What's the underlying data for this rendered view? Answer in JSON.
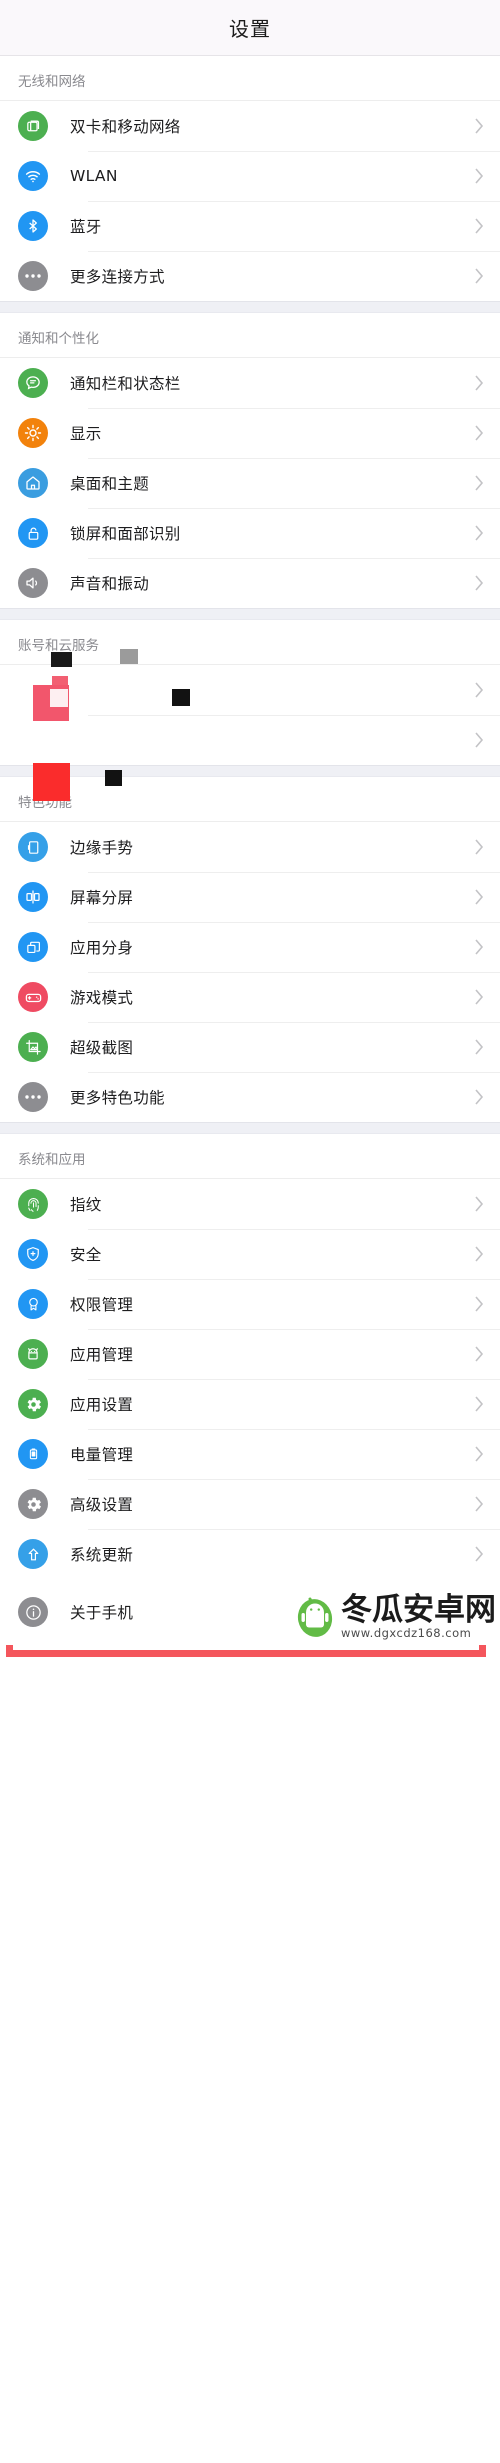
{
  "header": {
    "title": "设置"
  },
  "colors": {
    "green": "#4caf50",
    "blue": "#2196f3",
    "light_blue": "#35a0e8",
    "orange": "#f2820c",
    "gray": "#8d8d91",
    "red_pink": "#ef4b62",
    "highlight_border": "#f4565c",
    "page_bg": "#eff0f5",
    "titlebar_bg": "#faf8fb"
  },
  "sections": [
    {
      "title": "无线和网络",
      "items": [
        {
          "label": "双卡和移动网络",
          "icon": "sim-card-icon",
          "icon_color": "#4caf50"
        },
        {
          "label": "WLAN",
          "icon": "wifi-icon",
          "icon_color": "#2196f3"
        },
        {
          "label": "蓝牙",
          "icon": "bluetooth-icon",
          "icon_color": "#2196f3"
        },
        {
          "label": "更多连接方式",
          "icon": "more-dots-icon",
          "icon_color": "#8d8d91"
        }
      ]
    },
    {
      "title": "通知和个性化",
      "items": [
        {
          "label": "通知栏和状态栏",
          "icon": "chat-bubble-icon",
          "icon_color": "#4caf50"
        },
        {
          "label": "显示",
          "icon": "brightness-sun-icon",
          "icon_color": "#f2820c"
        },
        {
          "label": "桌面和主题",
          "icon": "home-icon",
          "icon_color": "#3a9de0"
        },
        {
          "label": "锁屏和面部识别",
          "icon": "lock-icon",
          "icon_color": "#2196f3"
        },
        {
          "label": "声音和振动",
          "icon": "speaker-icon",
          "icon_color": "#8d8d91"
        }
      ]
    },
    {
      "title": "账号和云服务",
      "redacted": true,
      "items": [
        {
          "label": "",
          "icon": "redacted-icon",
          "icon_color": "#ffffff"
        },
        {
          "label": "",
          "icon": "redacted-icon",
          "icon_color": "#ffffff"
        }
      ]
    },
    {
      "title": "特色功能",
      "items": [
        {
          "label": "边缘手势",
          "icon": "edge-gesture-icon",
          "icon_color": "#35a0e8"
        },
        {
          "label": "屏幕分屏",
          "icon": "split-screen-icon",
          "icon_color": "#2196f3"
        },
        {
          "label": "应用分身",
          "icon": "app-clone-icon",
          "icon_color": "#2196f3"
        },
        {
          "label": "游戏模式",
          "icon": "gamepad-icon",
          "icon_color": "#ef4b62"
        },
        {
          "label": "超级截图",
          "icon": "screenshot-icon",
          "icon_color": "#4caf50"
        },
        {
          "label": "更多特色功能",
          "icon": "more-dots-icon",
          "icon_color": "#8d8d91"
        }
      ]
    },
    {
      "title": "系统和应用",
      "items": [
        {
          "label": "指纹",
          "icon": "fingerprint-icon",
          "icon_color": "#4caf50"
        },
        {
          "label": "安全",
          "icon": "shield-icon",
          "icon_color": "#2196f3"
        },
        {
          "label": "权限管理",
          "icon": "badge-icon",
          "icon_color": "#2196f3"
        },
        {
          "label": "应用管理",
          "icon": "android-robot-icon",
          "icon_color": "#4caf50"
        },
        {
          "label": "应用设置",
          "icon": "gear-icon",
          "icon_color": "#4caf50"
        },
        {
          "label": "电量管理",
          "icon": "battery-icon",
          "icon_color": "#2196f3"
        },
        {
          "label": "高级设置",
          "icon": "gear-icon",
          "icon_color": "#8d8d91"
        },
        {
          "label": "系统更新",
          "icon": "arrow-up-icon",
          "icon_color": "#35a0e8"
        }
      ]
    }
  ],
  "highlighted_row": {
    "label": "关于手机",
    "icon": "info-icon",
    "icon_color": "#8d8d91"
  },
  "watermark": {
    "name": "冬瓜安卓网",
    "url": "www.dgxcdz168.com"
  }
}
